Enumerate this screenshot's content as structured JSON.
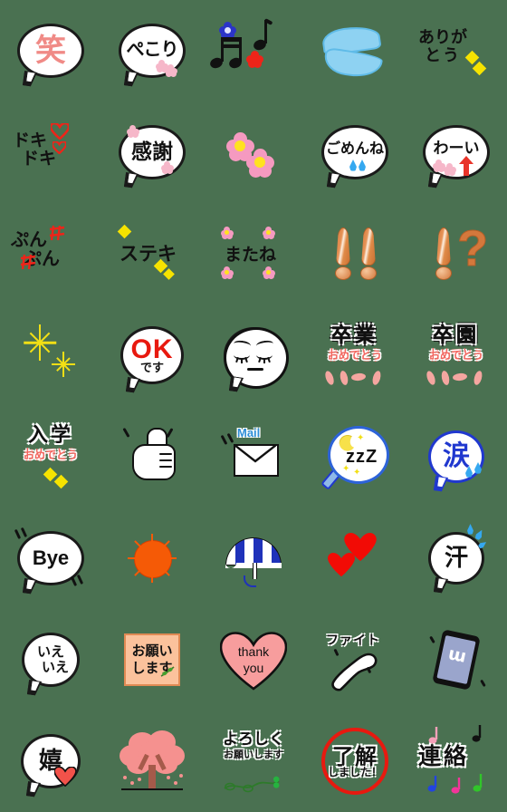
{
  "page": {
    "title": "Emoji sticker sheet",
    "background_color": "#4a7151",
    "grid": {
      "columns": 5,
      "rows": 8,
      "cell_size_px": 112
    }
  },
  "palette": {
    "background": "#4a7151",
    "outline": "#1a1a1a",
    "bubble_fill": "#ffffff",
    "pink_text": "#f08a86",
    "red": "#e8190f",
    "blue": "#2038cf",
    "light_blue": "#8ed2f2",
    "yellow": "#f6e300",
    "orange": "#f55a06",
    "tan": "#d4783c",
    "peach_card": "#fbc29c",
    "heart_pink": "#f79d9d",
    "sakura": "#f5918f",
    "green": "#26b33f"
  },
  "emojis": [
    {
      "id": "warai",
      "row": 1,
      "col": 1,
      "label": "笑",
      "type": "speech-bubble",
      "description": "pink 笑 in white speech bubble"
    },
    {
      "id": "pekori",
      "row": 1,
      "col": 2,
      "label": "ぺこり",
      "type": "speech-bubble",
      "description": "ぺこり bubble with pink flowers"
    },
    {
      "id": "music-notes",
      "row": 1,
      "col": 3,
      "label": "",
      "type": "icon",
      "description": "music notes with blue and red flowers"
    },
    {
      "id": "blue-wings",
      "row": 1,
      "col": 4,
      "label": "",
      "type": "icon",
      "description": "two light blue wing shapes"
    },
    {
      "id": "arigatou",
      "row": 1,
      "col": 5,
      "label": "ありがとう",
      "type": "text",
      "line1": "ありが",
      "line2": "とう",
      "description": "ありがとう with yellow sparkles"
    },
    {
      "id": "dokidoki",
      "row": 2,
      "col": 1,
      "label": "ドキドキ",
      "type": "text",
      "line1": "ドキ",
      "line2": "ドキ",
      "description": "ドキドキ with red outline hearts"
    },
    {
      "id": "kansha",
      "row": 2,
      "col": 2,
      "label": "感謝",
      "type": "speech-bubble",
      "description": "感謝 bubble with pink flowers"
    },
    {
      "id": "pink-flowers",
      "row": 2,
      "col": 3,
      "label": "",
      "type": "icon",
      "description": "two pink flowers with yellow centers"
    },
    {
      "id": "gomenne",
      "row": 2,
      "col": 4,
      "label": "ごめんね",
      "type": "speech-bubble",
      "description": "ごめんね bubble with blue sweat drops"
    },
    {
      "id": "waai",
      "row": 2,
      "col": 5,
      "label": "わーい",
      "type": "speech-bubble",
      "description": "わーい bubble with red arrow and flowers"
    },
    {
      "id": "punpun",
      "row": 3,
      "col": 1,
      "label": "ぷんぷん",
      "type": "text",
      "line1": "ぷん",
      "line2": "ぷん",
      "description": "ぷんぷん with red anger marks"
    },
    {
      "id": "suteki",
      "row": 3,
      "col": 2,
      "label": "ステキ",
      "type": "text",
      "description": "ステキ with yellow diamonds"
    },
    {
      "id": "matane",
      "row": 3,
      "col": 3,
      "label": "またね",
      "type": "text",
      "description": "またね with four pink flowers"
    },
    {
      "id": "double-exclaim",
      "row": 3,
      "col": 4,
      "label": "!!",
      "type": "icon",
      "description": "two orange exclamation marks"
    },
    {
      "id": "exclaim-question",
      "row": 3,
      "col": 5,
      "label": "!?",
      "type": "icon",
      "description": "orange exclamation and question mark"
    },
    {
      "id": "sparkle",
      "row": 4,
      "col": 1,
      "label": "",
      "type": "icon",
      "description": "two yellow sparkle stars"
    },
    {
      "id": "ok-desu",
      "row": 4,
      "col": 2,
      "label": "OKです",
      "type": "speech-bubble",
      "line1": "OK",
      "line2": "です",
      "description": "red OK with です in bubble"
    },
    {
      "id": "sad-face",
      "row": 4,
      "col": 3,
      "label": "",
      "type": "speech-bubble",
      "description": "white face bubble with closed eyes"
    },
    {
      "id": "sotsugyou",
      "row": 4,
      "col": 4,
      "label": "卒業おめでとう",
      "type": "text",
      "line1": "卒業",
      "line2": "おめでとう",
      "description": "卒業 おめでとう with pink petals"
    },
    {
      "id": "sotsuen",
      "row": 4,
      "col": 5,
      "label": "卒園おめでとう",
      "type": "text",
      "line1": "卒園",
      "line2": "おめでとう",
      "description": "卒園 おめでとう with pink petals"
    },
    {
      "id": "nyugaku",
      "row": 5,
      "col": 1,
      "label": "入学おめでとう",
      "type": "text",
      "line1": "入学",
      "line2": "おめでとう",
      "description": "入学 おめでとう with yellow diamonds"
    },
    {
      "id": "thumbs-up",
      "row": 5,
      "col": 2,
      "label": "",
      "type": "icon",
      "description": "white thumbs up fist"
    },
    {
      "id": "mail",
      "row": 5,
      "col": 3,
      "label": "Mail",
      "type": "icon",
      "description": "envelope with blue Mail text"
    },
    {
      "id": "sleeping",
      "row": 5,
      "col": 4,
      "label": "zzZ",
      "type": "speech-bubble",
      "description": "blue bubble with moon and zzZ"
    },
    {
      "id": "namida",
      "row": 5,
      "col": 5,
      "label": "涙",
      "type": "speech-bubble",
      "description": "blue 涙 bubble with tear drops"
    },
    {
      "id": "bye",
      "row": 6,
      "col": 1,
      "label": "Bye",
      "type": "speech-bubble",
      "description": "Bye in white speech bubble"
    },
    {
      "id": "sun",
      "row": 6,
      "col": 2,
      "label": "",
      "type": "icon",
      "description": "orange sun with rays"
    },
    {
      "id": "umbrella",
      "row": 6,
      "col": 3,
      "label": "",
      "type": "icon",
      "description": "blue and white striped umbrella"
    },
    {
      "id": "hearts",
      "row": 6,
      "col": 4,
      "label": "",
      "type": "icon",
      "description": "two red hearts"
    },
    {
      "id": "ase",
      "row": 6,
      "col": 5,
      "label": "汗",
      "type": "speech-bubble",
      "description": "汗 bubble with blue sweat splash"
    },
    {
      "id": "ieie",
      "row": 7,
      "col": 1,
      "label": "いえいえ",
      "type": "speech-bubble",
      "line1": "いえ",
      "line2": "いえ",
      "description": "いえいえ in white bubble"
    },
    {
      "id": "onegaishimasu",
      "row": 7,
      "col": 2,
      "label": "お願いします",
      "type": "card",
      "line1": "お願い",
      "line2": "します",
      "description": "お願いします on peach card with green sprig"
    },
    {
      "id": "thank-you",
      "row": 7,
      "col": 3,
      "label": "thank you",
      "type": "heart",
      "line1": "thank",
      "line2": "you",
      "description": "thank you in pink heart"
    },
    {
      "id": "fight",
      "row": 7,
      "col": 4,
      "label": "ファイト",
      "type": "text",
      "description": "ファイト with flexed white arm"
    },
    {
      "id": "phone",
      "row": 7,
      "col": 5,
      "label": "",
      "type": "icon",
      "description": "tilted smartphone with squiggle on screen"
    },
    {
      "id": "ureshii",
      "row": 8,
      "col": 1,
      "label": "嬉",
      "type": "speech-bubble",
      "description": "嬉 bubble with red heart"
    },
    {
      "id": "cherry-tree",
      "row": 8,
      "col": 2,
      "label": "",
      "type": "icon",
      "description": "pink cherry blossom tree"
    },
    {
      "id": "yoroshiku",
      "row": 8,
      "col": 3,
      "label": "よろしくお願いします",
      "type": "text",
      "line1": "よろしく",
      "line2": "お願いします",
      "description": "よろしくお願いします with green clover vine"
    },
    {
      "id": "ryokai",
      "row": 8,
      "col": 4,
      "label": "了解しました！",
      "type": "stamp",
      "line1": "了解",
      "line2": "しました！",
      "description": "了解しました in red circle stamp"
    },
    {
      "id": "renraku",
      "row": 8,
      "col": 5,
      "label": "連絡",
      "type": "text",
      "description": "連絡 with colorful music notes"
    }
  ]
}
